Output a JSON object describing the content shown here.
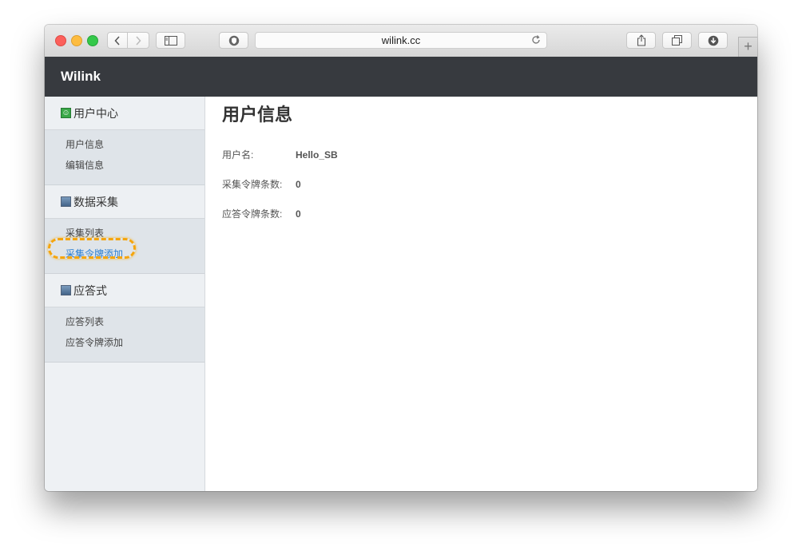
{
  "browser": {
    "url": "wilink.cc",
    "new_tab_label": "+"
  },
  "site": {
    "brand": "Wilink"
  },
  "sidebar": {
    "groups": [
      {
        "title": "用户中心",
        "items": [
          "用户信息",
          "编辑信息"
        ]
      },
      {
        "title": "数据采集",
        "items": [
          "采集列表",
          "采集令牌添加"
        ]
      },
      {
        "title": "应答式",
        "items": [
          "应答列表",
          "应答令牌添加"
        ]
      }
    ]
  },
  "main": {
    "title": "用户信息",
    "fields": [
      {
        "label": "用户名:",
        "value": "Hello_SB"
      },
      {
        "label": "采集令牌条数:",
        "value": "0"
      },
      {
        "label": "应答令牌条数:",
        "value": "0"
      }
    ]
  },
  "colors": {
    "header_bg": "#373a3f",
    "active_link": "#2b7fd3",
    "highlight": "#f5a50d"
  }
}
